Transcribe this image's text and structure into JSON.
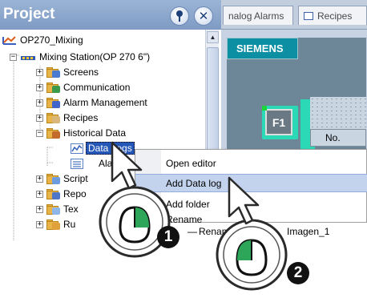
{
  "panel": {
    "title": "Project"
  },
  "tree": {
    "root": "OP270_Mixing",
    "station": "Mixing Station(OP 270 6\")",
    "items": [
      {
        "label": "Screens"
      },
      {
        "label": "Communication"
      },
      {
        "label": "Alarm Management"
      },
      {
        "label": "Recipes"
      },
      {
        "label": "Historical Data"
      },
      {
        "label": "Data Logs"
      },
      {
        "label": "Alarm Logs",
        "visible": "Ala    Log"
      },
      {
        "label": "Scripts",
        "visible": "Script"
      },
      {
        "label": "Reports",
        "visible": "Repo"
      },
      {
        "label": "Text",
        "visible": "Tex"
      },
      {
        "label": "Runtime",
        "visible": "Ru"
      }
    ]
  },
  "tabs": [
    {
      "label": "nalog Alarms"
    },
    {
      "label": "Recipes"
    }
  ],
  "hmi": {
    "brand": "SIEMENS",
    "f1_label": "F1",
    "column_header": "No."
  },
  "context_menu": {
    "items": [
      {
        "label": "Open editor"
      },
      {
        "label": "Add Data log"
      },
      {
        "label": "Add folder"
      },
      {
        "label": "Rename"
      }
    ],
    "rename_prefix": "—",
    "trailing_text": "Imagen_1"
  },
  "callouts": [
    "1",
    "2"
  ],
  "colors": {
    "header": "#8ea8cf",
    "selection": "#2457b8",
    "menu_highlight": "#c3d3ee",
    "hmi_teal": "#2bd9b6",
    "siemens_bar": "#0c8fa3"
  }
}
